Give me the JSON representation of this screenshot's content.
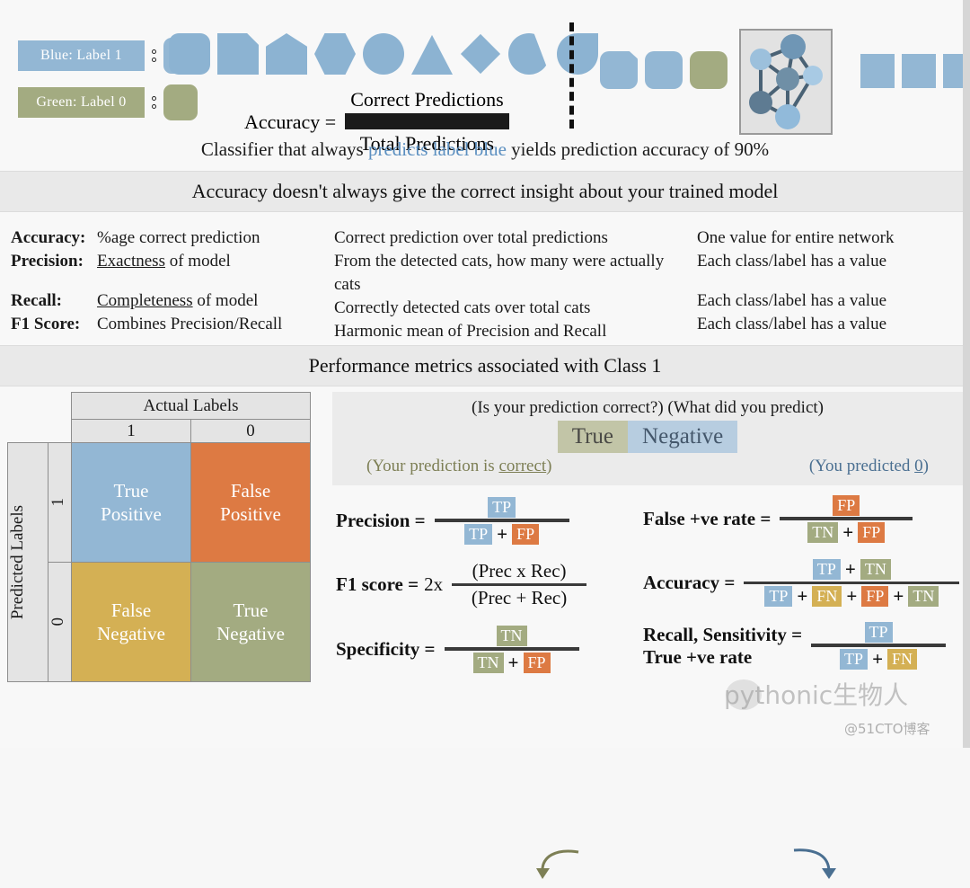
{
  "legend": {
    "items": [
      {
        "label": "Blue: Label 1",
        "color": "#93b7d4"
      },
      {
        "label": "Green: Label 0",
        "color": "#a3ab81"
      }
    ]
  },
  "accuracy_formula": {
    "lhs": "Accuracy =",
    "numerator": "Correct Predictions",
    "denominator": "Total Predictions"
  },
  "caption": {
    "before": "Classifier that always ",
    "highlight": "predicts label blue",
    "after": " yields prediction accuracy of 90%"
  },
  "headers": {
    "bar1": "Accuracy doesn't always give the correct insight about your trained model",
    "bar2": "Performance metrics associated with Class 1"
  },
  "definitions": {
    "left": [
      {
        "key": "Accuracy:",
        "value": "%age correct prediction",
        "underline": false
      },
      {
        "key": "Precision:",
        "value": "Exactness of model",
        "underline": true
      },
      {
        "key": "Recall:",
        "value": "Completeness of model",
        "underline": true
      },
      {
        "key": "F1 Score:",
        "value": "Combines Precision/Recall",
        "underline": false
      }
    ],
    "middle": [
      "Correct prediction over total predictions",
      "From the detected cats, how many were actually cats",
      "Correctly detected cats over total cats",
      "Harmonic mean of Precision and Recall"
    ],
    "right": [
      "One value for entire network",
      "Each class/label has a value",
      "Each class/label has a value",
      "Each class/label has a value"
    ]
  },
  "confusion_matrix": {
    "col_group_header": "Actual Labels",
    "col_headers": [
      "1",
      "0"
    ],
    "row_group_header": "Predicted Labels",
    "row_headers": [
      "1",
      "0"
    ],
    "cells": [
      {
        "line1": "True",
        "line2": "Positive",
        "color": "#93b7d4"
      },
      {
        "line1": "False",
        "line2": "Positive",
        "color": "#dd7a43"
      },
      {
        "line1": "False",
        "line2": "Negative",
        "color": "#d4b054"
      },
      {
        "line1": "True",
        "line2": "Negative",
        "color": "#a3ab81"
      }
    ]
  },
  "explainer": {
    "question_left": "(Is your prediction correct?)",
    "question_right": "(What did you predict)",
    "word_left": "True",
    "word_right": "Negative",
    "answer_left": "(Your prediction is correct)",
    "answer_right": "(You predicted 0)"
  },
  "formulas": {
    "precision": {
      "label": "Precision =",
      "num": [
        "TP"
      ],
      "den": [
        "TP",
        "+",
        "FP"
      ]
    },
    "f1": {
      "label": "F1 score =",
      "multiplier": "2x",
      "num": "(Prec x Rec)",
      "den": "(Prec + Rec)"
    },
    "specificity": {
      "label": "Specificity =",
      "num": [
        "TN"
      ],
      "den": [
        "TN",
        "+",
        "FP"
      ]
    },
    "false_positive_rate": {
      "label": "False +ve rate =",
      "num": [
        "FP"
      ],
      "den": [
        "TN",
        "+",
        "FP"
      ]
    },
    "accuracy": {
      "label": "Accuracy =",
      "num": [
        "TP",
        "+",
        "TN"
      ],
      "den": [
        "TP",
        "+",
        "FN",
        "+",
        "FP",
        "+",
        "TN"
      ]
    },
    "recall": {
      "label_line1": "Recall, Sensitivity =",
      "label_line2": "True +ve rate",
      "num": [
        "TP"
      ],
      "den": [
        "TP",
        "+",
        "FN"
      ]
    }
  },
  "watermark": {
    "main": "pythonic生物人",
    "sub": "@51CTO博客"
  }
}
